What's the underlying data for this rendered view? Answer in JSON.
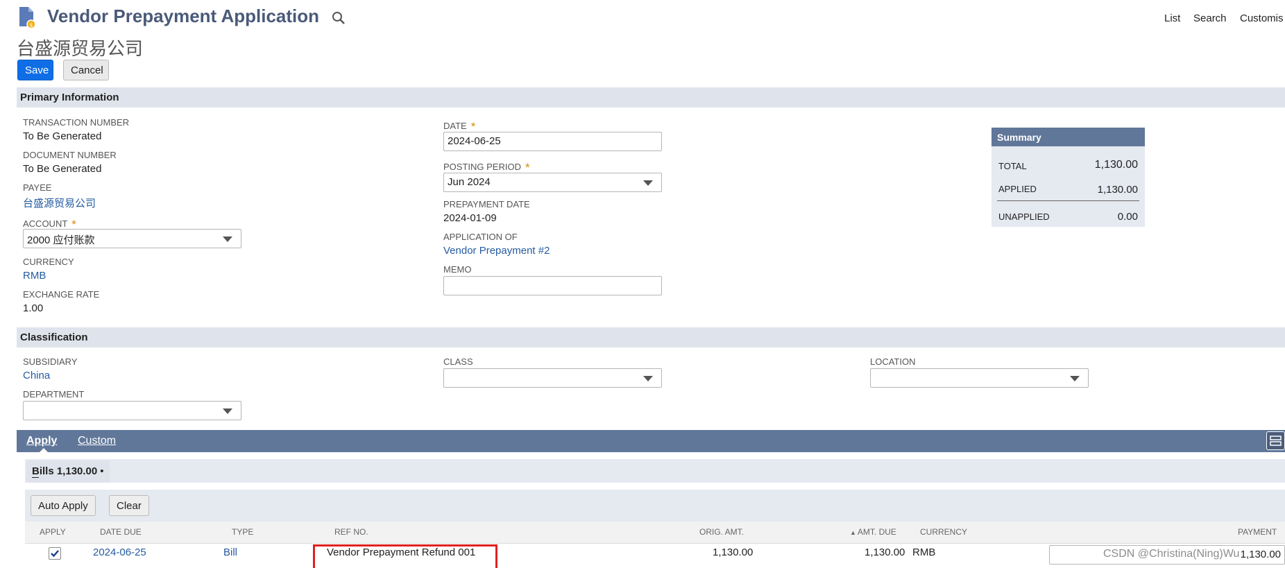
{
  "header": {
    "title": "Vendor Prepayment Application",
    "vendor_name": "台盛源贸易公司",
    "nav": [
      "List",
      "Search",
      "Customis"
    ]
  },
  "actions": {
    "save": "Save",
    "cancel": "Cancel"
  },
  "primary": {
    "section_title": "Primary Information",
    "transaction_number_label": "TRANSACTION NUMBER",
    "transaction_number": "To Be Generated",
    "document_number_label": "DOCUMENT NUMBER",
    "document_number": "To Be Generated",
    "payee_label": "PAYEE",
    "payee": "台盛源贸易公司",
    "account_label": "ACCOUNT",
    "account": "2000 应付账款",
    "currency_label": "CURRENCY",
    "currency": "RMB",
    "exchange_rate_label": "EXCHANGE RATE",
    "exchange_rate": "1.00",
    "date_label": "DATE",
    "date": "2024-06-25",
    "posting_period_label": "POSTING PERIOD",
    "posting_period": "Jun 2024",
    "prepayment_date_label": "PREPAYMENT DATE",
    "prepayment_date": "2024-01-09",
    "application_of_label": "APPLICATION OF",
    "application_of": "Vendor Prepayment #2",
    "memo_label": "MEMO",
    "memo": ""
  },
  "summary": {
    "title": "Summary",
    "total_label": "TOTAL",
    "total": "1,130.00",
    "applied_label": "APPLIED",
    "applied": "1,130.00",
    "unapplied_label": "UNAPPLIED",
    "unapplied": "0.00"
  },
  "classification": {
    "section_title": "Classification",
    "subsidiary_label": "SUBSIDIARY",
    "subsidiary": "China",
    "class_label": "CLASS",
    "class_value": "",
    "location_label": "LOCATION",
    "location": "",
    "department_label": "DEPARTMENT",
    "department": ""
  },
  "tabs": {
    "apply": "Apply",
    "custom": "Custom"
  },
  "bills": {
    "subtab_label": "Bills 1,130.00",
    "auto_apply": "Auto Apply",
    "clear": "Clear",
    "columns": {
      "apply": "APPLY",
      "date_due": "DATE DUE",
      "type": "TYPE",
      "ref_no": "REF NO.",
      "orig_amt": "ORIG. AMT.",
      "amt_due": "AMT. DUE",
      "currency": "CURRENCY",
      "payment": "PAYMENT"
    },
    "rows": [
      {
        "apply": true,
        "date_due": "2024-06-25",
        "type": "Bill",
        "ref_no": "Vendor Prepayment Refund 001",
        "orig_amt": "1,130.00",
        "amt_due": "1,130.00",
        "currency": "RMB",
        "payment": "1,130.00"
      }
    ]
  },
  "watermark": "CSDN @Christina(Ning)Wu",
  "colors": {
    "primary_button": "#0f6ee6",
    "band": "#dfe4ec",
    "tab_bar": "#607799",
    "link": "#255ba1",
    "highlight": "#e02020"
  }
}
